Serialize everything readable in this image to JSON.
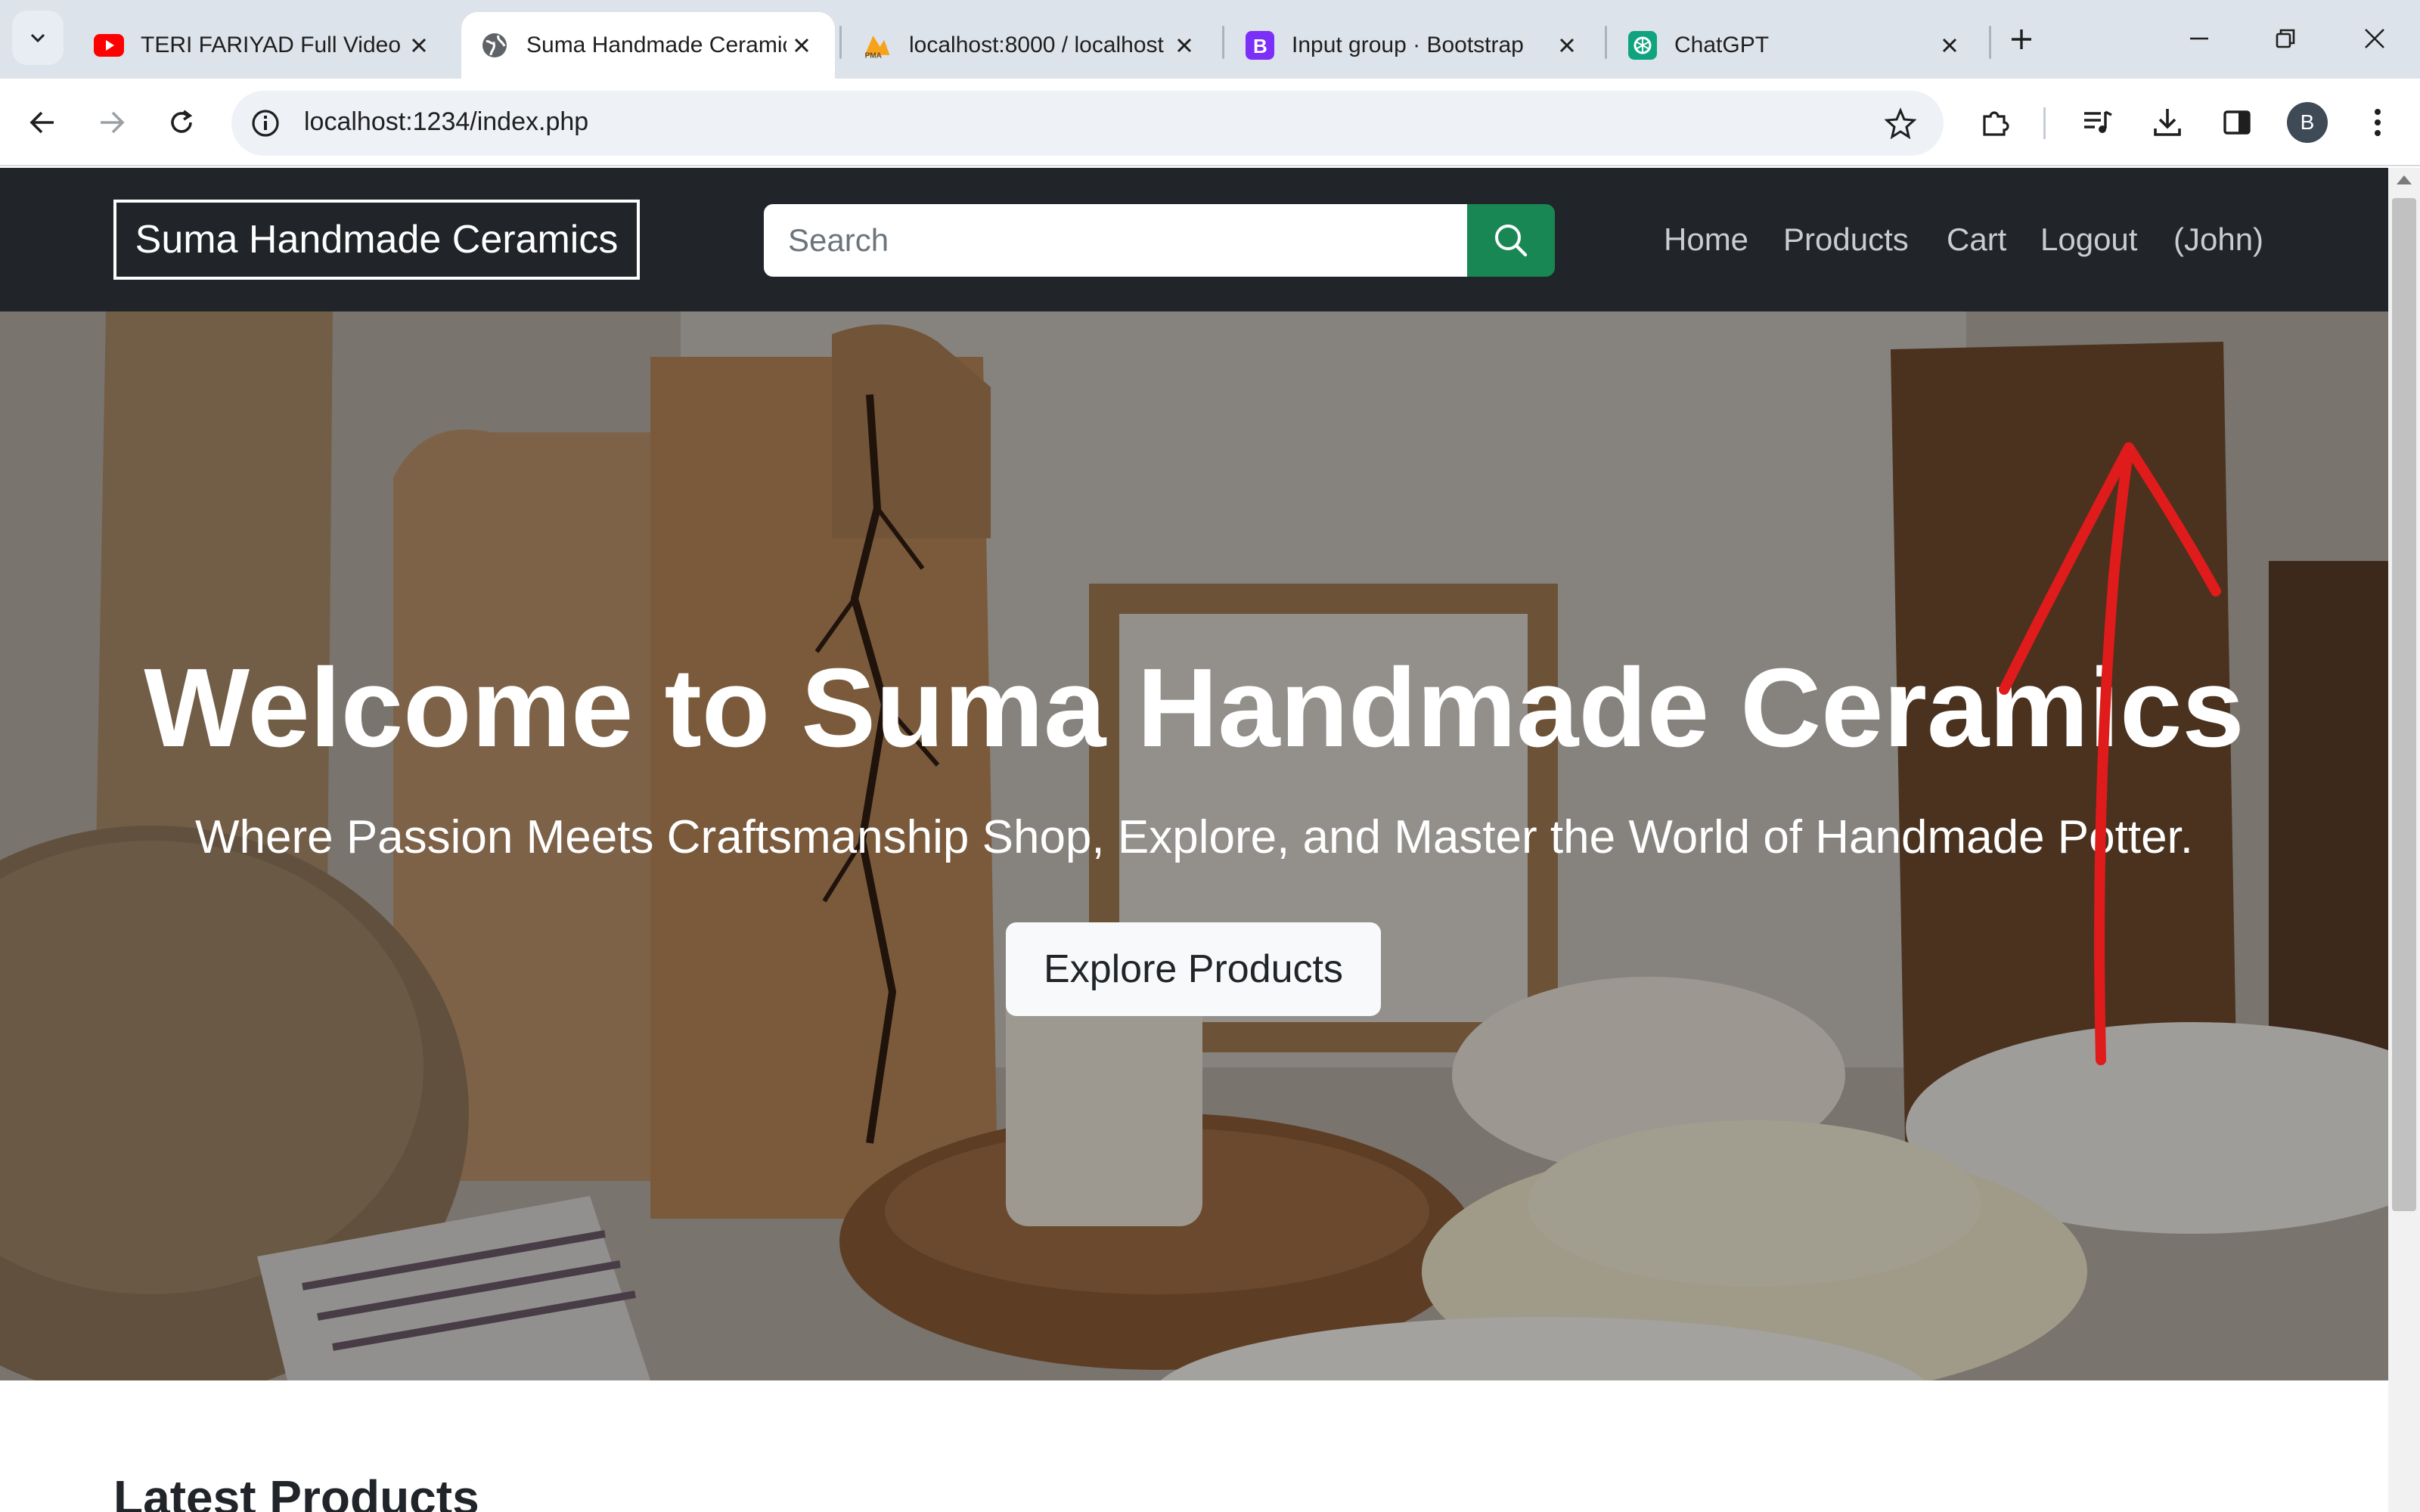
{
  "browser": {
    "tabs": [
      {
        "title": "TERI FARIYAD Full Video",
        "favicon": "youtube-icon",
        "active": false
      },
      {
        "title": "Suma Handmade Ceramics",
        "favicon": "globe-icon",
        "active": true
      },
      {
        "title": "localhost:8000 / localhost",
        "favicon": "phpmyadmin-icon",
        "active": false
      },
      {
        "title": "Input group · Bootstrap",
        "favicon": "bootstrap-icon",
        "active": false
      },
      {
        "title": "ChatGPT",
        "favicon": "chatgpt-icon",
        "active": false
      }
    ],
    "address": "localhost:1234/index.php",
    "profile_initial": "B"
  },
  "site": {
    "brand": "Suma Handmade Ceramics",
    "search_placeholder": "Search",
    "nav": {
      "home": "Home",
      "products": "Products",
      "cart": "Cart",
      "logout": "Logout",
      "user": "(John)"
    },
    "hero": {
      "title": "Welcome to Suma Handmade Ceramics",
      "subtitle": "Where Passion Meets Craftsmanship Shop, Explore, and Master the World of Handmade Potter.",
      "button": "Explore Products"
    },
    "latest_title": "Latest Products"
  },
  "colors": {
    "navbar_bg": "#212529",
    "search_button": "#198754",
    "annotation_arrow": "#e01b1b",
    "tabstrip_bg": "#dde3ea"
  }
}
